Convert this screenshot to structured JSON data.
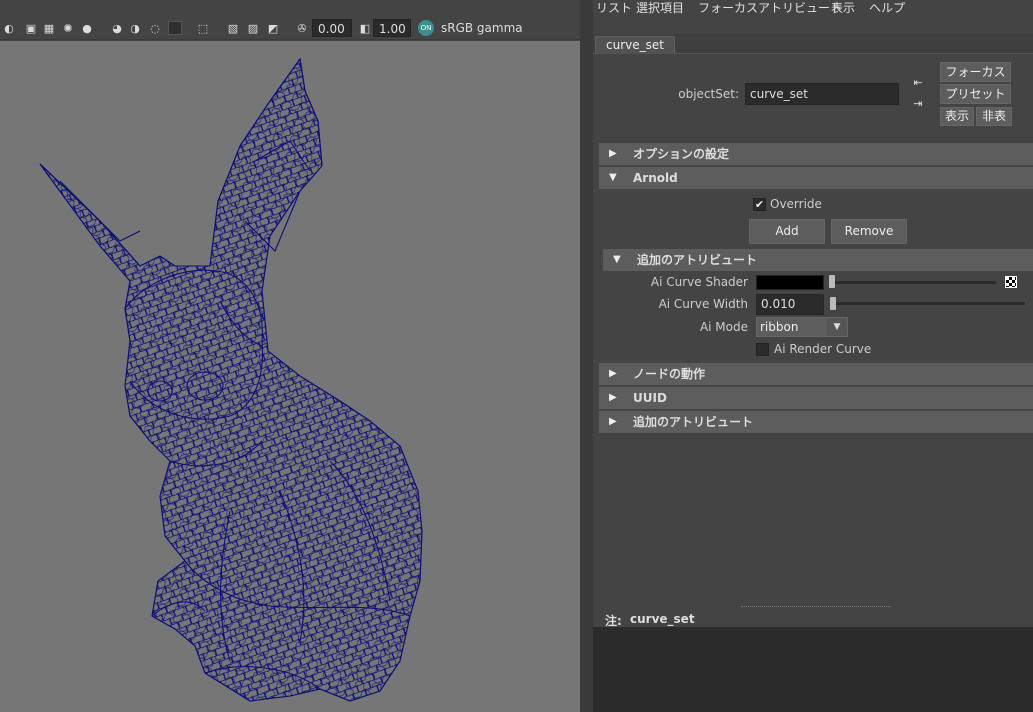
{
  "viewport": {
    "toolbar": {
      "exposure_value": "0.00",
      "gamma_value": "1.00",
      "colorspace_label": "sRGB gamma"
    }
  },
  "menubar": {
    "items": [
      "リスト",
      "選択項目",
      "フォーカス",
      "アトリビュート",
      "表示",
      "ヘルプ"
    ]
  },
  "tab": {
    "label": "curve_set"
  },
  "object_set": {
    "label": "objectSet:",
    "value": "curve_set"
  },
  "buttons": {
    "focus": "フォーカス",
    "preset": "プリセット",
    "show": "表示",
    "hide": "非表示"
  },
  "sections": {
    "options": "オプションの設定",
    "arnold": "Arnold",
    "extra_attrs": "追加のアトリビュート",
    "node_behavior": "ノードの動作",
    "uuid": "UUID",
    "extra_attrs2": "追加のアトリビュート"
  },
  "arnold": {
    "override_label": "Override",
    "override_checked": true,
    "add_label": "Add",
    "remove_label": "Remove",
    "curve_shader_label": "Ai Curve Shader",
    "curve_width_label": "Ai Curve Width",
    "curve_width_value": "0.010",
    "mode_label": "Ai Mode",
    "mode_value": "ribbon",
    "render_curve_label": "Ai Render Curve",
    "render_curve_checked": false
  },
  "notes": {
    "label": "注:",
    "value": "curve_set"
  },
  "colors": {
    "wireframe": "#0d0f7a",
    "viewport_bg": "#767676",
    "panel_bg": "#444444"
  }
}
